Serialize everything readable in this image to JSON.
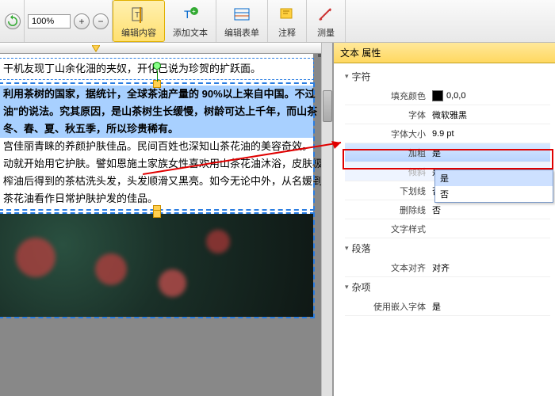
{
  "toolbar": {
    "zoom_value": "100%",
    "edit_content": "编辑内容",
    "add_text": "添加文本",
    "edit_form": "编辑表单",
    "annotate": "注释",
    "measure": "测量"
  },
  "document": {
    "line_top": "干机友现丁山余化沺的夹奴，开化已说为珍贺的扩跃面。",
    "hl1": "利用茶树的国家，据统计，全球茶油产量的   90%以上来自中国。不过",
    "hl2": "油\"的说法。究其原因，是山茶树生长缓慢，树龄可达上千年，而山茶",
    "hl3": "冬、春、夏、秋五季，所以珍贵稀有。",
    "p1": "宫佳丽青睐的养颜护肤佳品。民间百姓也深知山茶花油的美容奇效。",
    "p2": "动就开始用它护肤。譬如恩施土家族女性喜欢用山茶花油沐浴，皮肤极",
    "p3": "榨油后得到的茶枯洗头发，头发顺滑又黑亮。如今无论中外，从名媛到",
    "p4": "茶花油看作日常护肤护发的佳品。"
  },
  "panel": {
    "title": "文本 属性",
    "sections": {
      "char": "字符",
      "para": "段落",
      "misc": "杂项"
    },
    "props": {
      "fill_color": {
        "label": "填充颜色",
        "value": "0,0,0"
      },
      "font": {
        "label": "字体",
        "value": "微软雅黑"
      },
      "font_size": {
        "label": "字体大小",
        "value": "9.9 pt"
      },
      "bold": {
        "label": "加粗",
        "value": "是"
      },
      "italic": {
        "label": "倾斜",
        "value": "是"
      },
      "underline": {
        "label": "下划线",
        "value": "否"
      },
      "strike": {
        "label": "删除线",
        "value": "否"
      },
      "text_style": {
        "label": "文字样式",
        "value": ""
      },
      "align": {
        "label": "文本对齐",
        "value": "对齐"
      },
      "embed_font": {
        "label": "使用嵌入字体",
        "value": "是"
      }
    },
    "dropdown": {
      "opt_yes": "是",
      "opt_no": "否"
    }
  }
}
